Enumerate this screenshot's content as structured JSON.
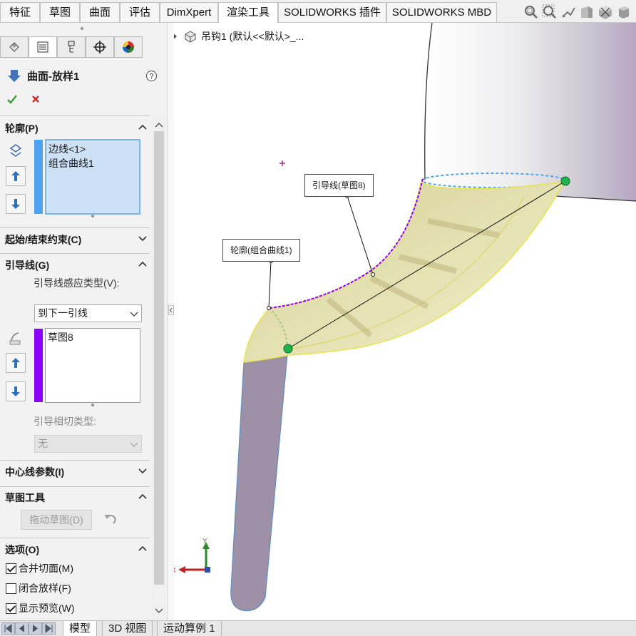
{
  "tabs": [
    "特征",
    "草图",
    "曲面",
    "评估",
    "DimXpert",
    "渲染工具",
    "SOLIDWORKS 插件",
    "SOLIDWORKS MBD"
  ],
  "active_tab_index": 5,
  "view_tools": [
    "zoom-to-fit-icon",
    "zoom-to-area-icon",
    "previous-view-icon",
    "section-view-icon",
    "view-orientation-icon",
    "display-style-icon"
  ],
  "pm": {
    "tab_icons": [
      "feature-manager-icon",
      "property-manager-icon",
      "configuration-manager-icon",
      "dimxpert-manager-icon",
      "display-manager-icon"
    ],
    "feature_title": "曲面-放样1",
    "help_icon": "?",
    "sections": {
      "profiles": {
        "title": "轮廓(P)",
        "items": [
          "边线<1>",
          "组合曲线1"
        ],
        "color": "#4da3ef"
      },
      "constraints": {
        "title": "起始/结束约束(C)"
      },
      "guides": {
        "title": "引导线(G)",
        "influence_label": "引导线感应类型(V):",
        "influence_value": "到下一引线",
        "items": [
          "草图8"
        ],
        "color": "#8b00ff",
        "tangency_label": "引导相切类型:",
        "tangency_value": "无"
      },
      "centerline": {
        "title": "中心线参数(I)"
      },
      "sketch_tools": {
        "title": "草图工具",
        "drag_button": "拖动草图(D)"
      },
      "options": {
        "title": "选项(O)",
        "checkboxes": [
          {
            "label": "合并切面(M)",
            "checked": true
          },
          {
            "label": "闭合放样(F)",
            "checked": false
          },
          {
            "label": "显示预览(W)",
            "checked": true
          }
        ]
      }
    }
  },
  "graphics": {
    "tree_flyout": "吊钩1  (默认<<默认>_...",
    "callouts": {
      "guide": "引导线(草图8)",
      "profile": "轮廓(组合曲线1)"
    },
    "triad": {
      "x": "X",
      "y": "Y"
    }
  },
  "bottom": {
    "tabs": [
      "模型",
      "3D 视图",
      "运动算例 1"
    ],
    "active_index": 0
  }
}
